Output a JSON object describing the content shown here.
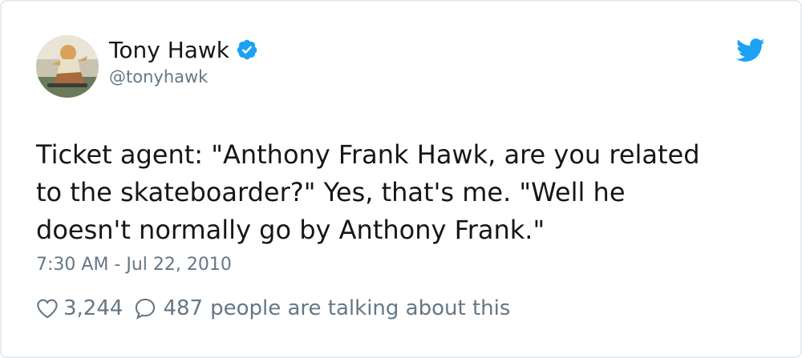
{
  "author": {
    "display_name": "Tony Hawk",
    "handle": "@tonyhawk",
    "verified": true,
    "avatar_icon": "skateboarder-photo"
  },
  "tweet": {
    "text": "Ticket agent: \"Anthony Frank Hawk, are you related\nto the skateboarder?\" Yes, that's me. \"Well he\ndoesn't normally go by Anthony Frank.\"",
    "timestamp": "7:30 AM - Jul 22, 2010"
  },
  "engagement": {
    "like_icon": "heart-icon",
    "likes": "3,244",
    "reply_icon": "speech-bubble-icon",
    "replies": "487",
    "talking_label": "people are talking about this"
  },
  "brand": {
    "logo_icon": "twitter-bird-icon",
    "twitter_blue": "#1da1f2",
    "secondary_text": "#657786",
    "primary_text": "#14171a"
  }
}
